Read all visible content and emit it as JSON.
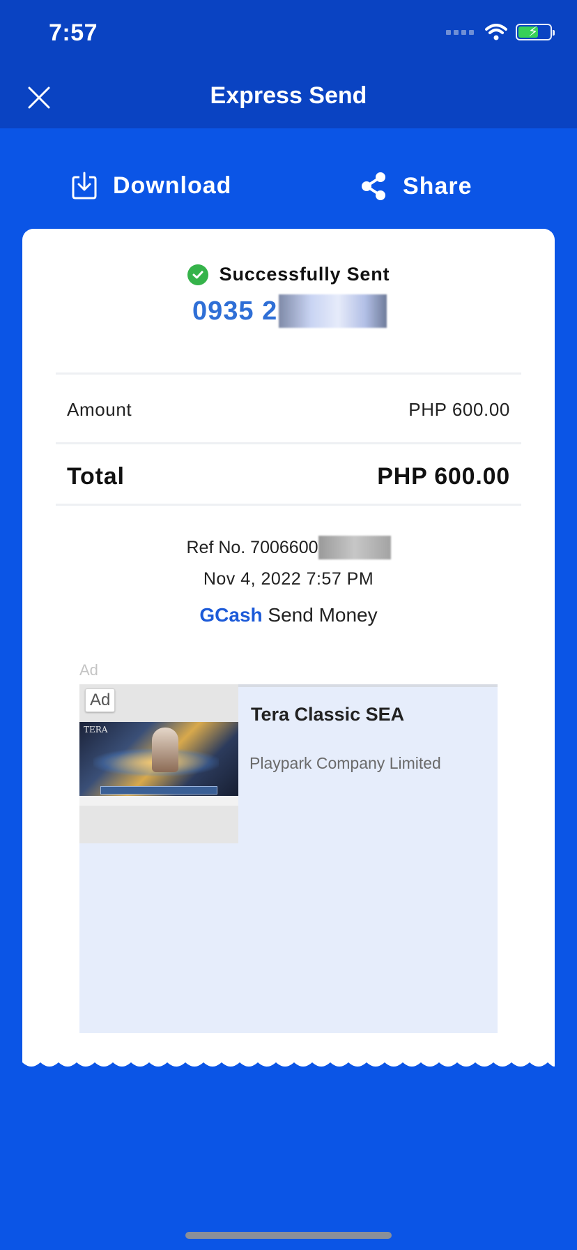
{
  "status_bar": {
    "time": "7:57"
  },
  "header": {
    "title": "Express Send"
  },
  "actions": {
    "download_label": "Download",
    "share_label": "Share"
  },
  "receipt": {
    "status_text": "Successfully Sent",
    "recipient_number_visible": "0935 2",
    "amount_label": "Amount",
    "amount_value": "PHP 600.00",
    "total_label": "Total",
    "total_value": "PHP 600.00",
    "ref_label": "Ref No. 7006600",
    "datetime": "Nov 4, 2022 7:57 PM",
    "brand": "GCash",
    "service": "Send Money"
  },
  "ad": {
    "label_small": "Ad",
    "badge": "Ad",
    "title": "Tera Classic SEA",
    "company": "Playpark Company Limited",
    "image_text": "TERA"
  },
  "colors": {
    "header_bg": "#0a43c2",
    "page_bg": "#0b55e6",
    "accent_blue": "#2f6fd6",
    "success_green": "#35b34a"
  }
}
